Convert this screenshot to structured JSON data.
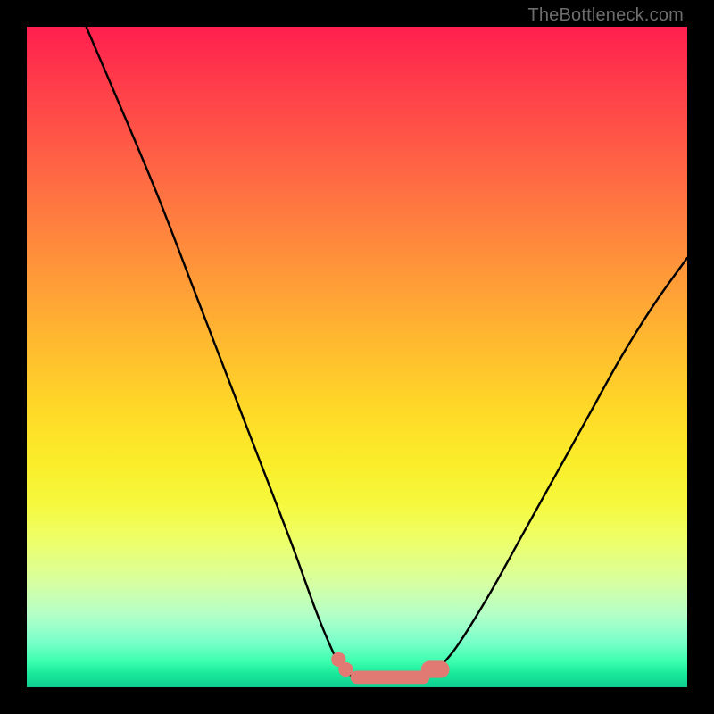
{
  "attribution": "TheBottleneck.com",
  "chart_data": {
    "type": "line",
    "title": "",
    "xlabel": "",
    "ylabel": "",
    "xlim": [
      0,
      100
    ],
    "ylim": [
      0,
      100
    ],
    "series": [
      {
        "name": "left-curve",
        "x": [
          9,
          15,
          20,
          25,
          30,
          35,
          40,
          44,
          47,
          48.5
        ],
        "values": [
          100,
          86,
          74,
          61,
          48,
          35,
          22,
          11,
          4,
          2
        ]
      },
      {
        "name": "plateau",
        "x": [
          48.5,
          50,
          52,
          54,
          56,
          58,
          60,
          61.5
        ],
        "values": [
          2,
          1.6,
          1.4,
          1.3,
          1.3,
          1.4,
          1.6,
          2
        ]
      },
      {
        "name": "right-curve",
        "x": [
          61.5,
          65,
          70,
          75,
          80,
          85,
          90,
          95,
          100
        ],
        "values": [
          2,
          6,
          14,
          23,
          32,
          41,
          50,
          58,
          65
        ]
      }
    ],
    "markers": [
      {
        "name": "left-dot-1",
        "x": 47.2,
        "y": 4.2,
        "r": 1.1
      },
      {
        "name": "left-dot-2",
        "x": 48.3,
        "y": 2.7,
        "r": 1.1
      },
      {
        "name": "plateau-bar",
        "from_x": 50,
        "to_x": 60,
        "y": 1.5,
        "r": 1.0
      },
      {
        "name": "right-blob",
        "from_x": 61,
        "to_x": 62.7,
        "y": 2.7,
        "r": 1.3
      }
    ],
    "marker_color": "#e17a72",
    "curve_color": "#000000",
    "gradient_stops": [
      {
        "pct": 0,
        "color": "#ff1f4f"
      },
      {
        "pct": 50,
        "color": "#ffd000"
      },
      {
        "pct": 80,
        "color": "#f2ff60"
      },
      {
        "pct": 100,
        "color": "#0fcf92"
      }
    ]
  }
}
